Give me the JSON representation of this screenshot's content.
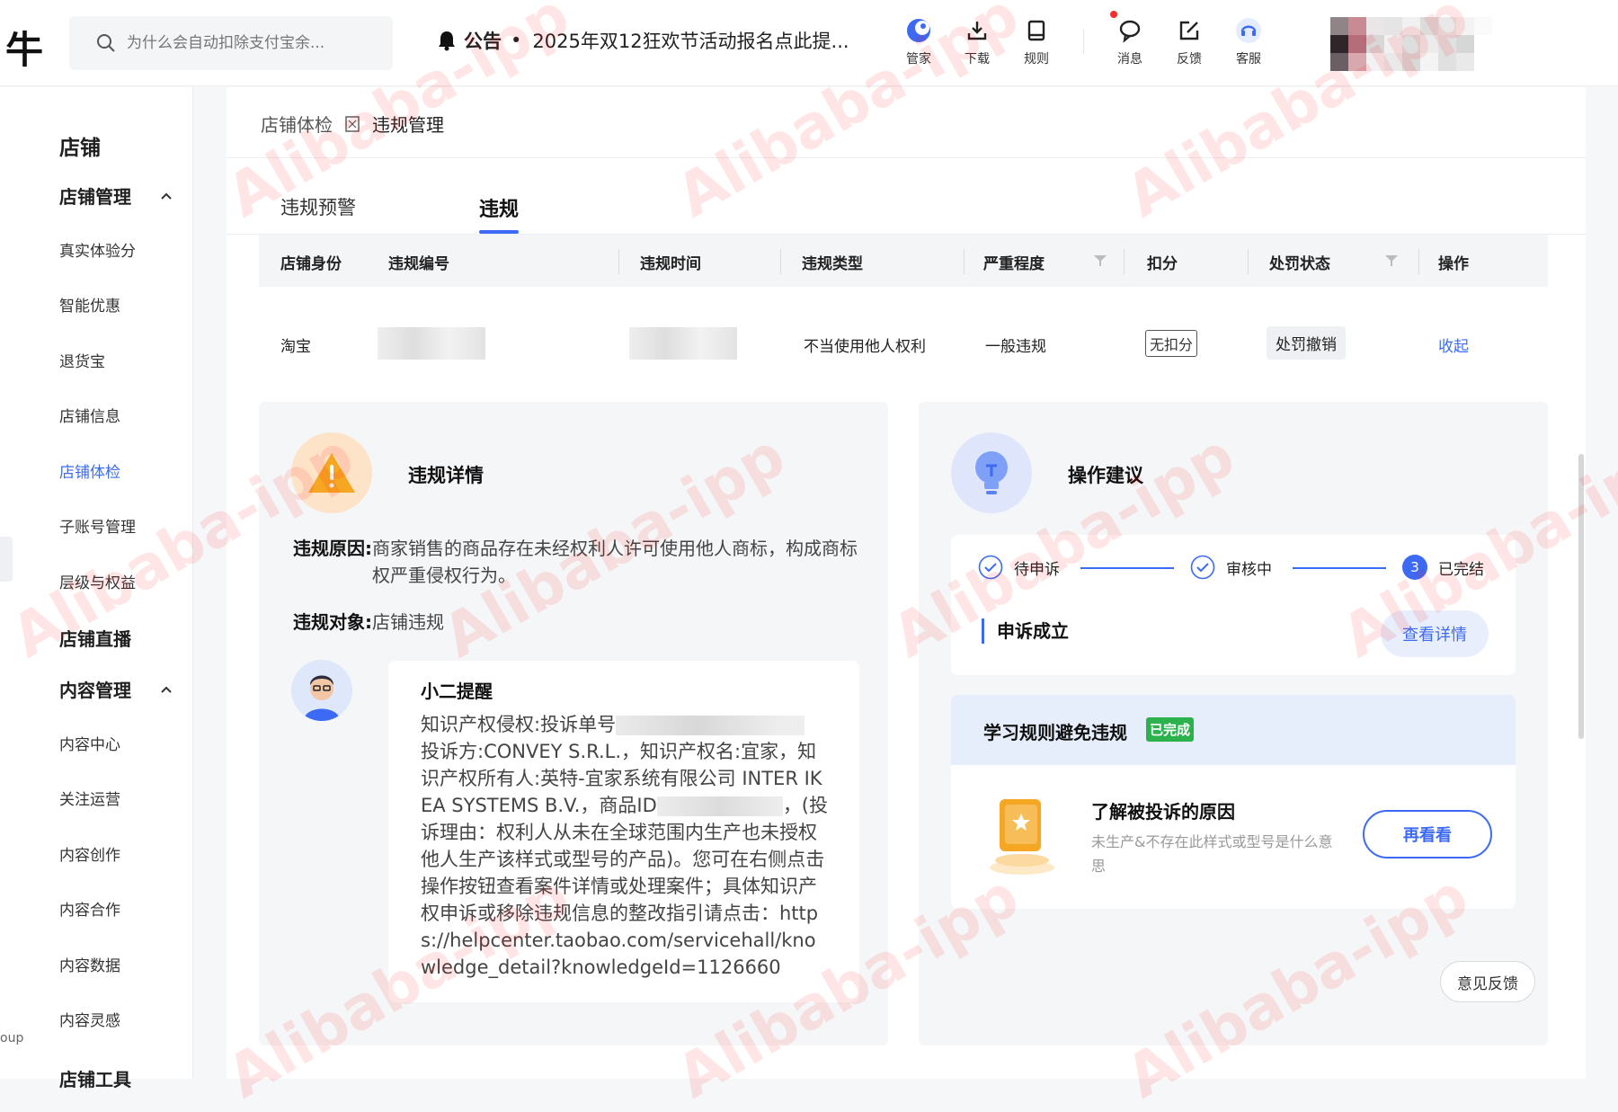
{
  "topbar": {
    "logo": "牛",
    "search_placeholder": "为什么会自动扣除支付宝余...",
    "notice_label": "公告",
    "notice_dot": "•",
    "notice_text": "2025年双12狂欢节活动报名点此提...",
    "tools": [
      {
        "label": "管家",
        "icon": "butler-icon"
      },
      {
        "label": "下载",
        "icon": "download-icon"
      },
      {
        "label": "规则",
        "icon": "rules-icon"
      },
      {
        "label": "消息",
        "icon": "message-icon"
      },
      {
        "label": "反馈",
        "icon": "feedback-icon"
      },
      {
        "label": "客服",
        "icon": "customer-service-icon"
      }
    ]
  },
  "sidebar": {
    "section1": "店铺",
    "group1": "店铺管理",
    "group1_items": [
      "真实体验分",
      "智能优惠",
      "退货宝",
      "店铺信息",
      "店铺体检",
      "子账号管理",
      "层级与权益"
    ],
    "active_item": "店铺体检",
    "section2": "店铺直播",
    "group2": "内容管理",
    "group2_items": [
      "内容中心",
      "关注运营",
      "内容创作",
      "内容合作",
      "内容数据",
      "内容灵感"
    ],
    "section3": "店铺工具",
    "side_group_hint": "oup"
  },
  "breadcrumb": {
    "parent": "店铺体检",
    "current": "违规管理"
  },
  "tabs": [
    {
      "label": "违规预警",
      "active": false
    },
    {
      "label": "违规",
      "active": true
    }
  ],
  "table": {
    "headers": [
      "店铺身份",
      "违规编号",
      "违规时间",
      "违规类型",
      "严重程度",
      "扣分",
      "处罚状态",
      "操作"
    ],
    "row": {
      "identity": "淘宝",
      "violation_type": "不当使用他人权利",
      "severity": "一般违规",
      "deduction": "无扣分",
      "penalty_status": "处罚撤销",
      "action": "收起"
    }
  },
  "details": {
    "title": "违规详情",
    "reason_label": "违规原因:",
    "reason": "商家销售的商品存在未经权利人许可使用他人商标，构成商标权严重侵权行为。",
    "object_label": "违规对象:",
    "object": "店铺违规",
    "reminder_title": "小二提醒",
    "reminder_p1": "知识产权侵权:投诉单号",
    "reminder_p2": " 投诉方:CONVEY S.R.L.，知识产权名:宜家，知识产权所有人:英特-宜家系统有限公司 INTER IKEA SYSTEMS B.V.，商品ID",
    "reminder_p3": "，(投诉理由：权利人从未在全球范围内生产也未授权他人生产该样式或型号的产品)。您可在右侧点击操作按钮查看案件详情或处理案件；具体知识产权申诉或移除违规信息的整改指引请点击：https://helpcenter.taobao.com/servicehall/knowledge_detail?knowledgeId=1126660"
  },
  "advice": {
    "title": "操作建议",
    "steps": [
      {
        "label": "待申诉",
        "state": "done"
      },
      {
        "label": "审核中",
        "state": "done"
      },
      {
        "label": "已完结",
        "state": "current",
        "number": "3"
      }
    ],
    "result": "申诉成立",
    "detail_button": "查看详情",
    "learn_title": "学习规则避免违规",
    "learn_badge": "已完成",
    "learn_item_title": "了解被投诉的原因",
    "learn_item_desc": "未生产&不存在此样式或型号是什么意思",
    "learn_button": "再看看",
    "feedback_button": "意见反馈"
  },
  "watermark": "Alibaba-ipp",
  "colors": {
    "accent": "#3d6af5",
    "success": "#2bb24c",
    "warning": "#f5a623"
  }
}
